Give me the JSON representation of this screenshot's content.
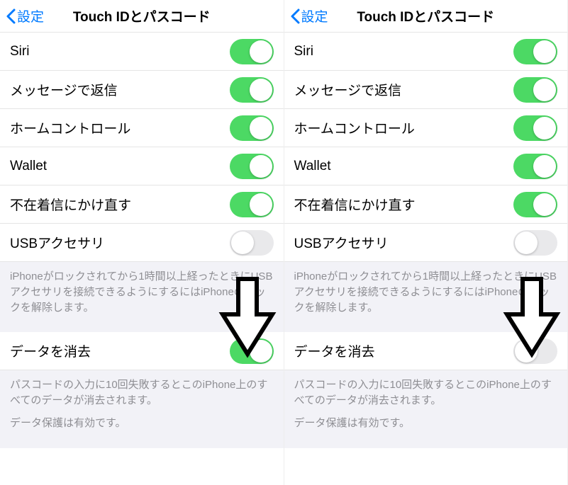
{
  "header": {
    "back_label": "設定",
    "title": "Touch IDとパスコード"
  },
  "rows": {
    "siri": {
      "label": "Siri",
      "on": true
    },
    "reply_message": {
      "label": "メッセージで返信",
      "on": true
    },
    "home_control": {
      "label": "ホームコントロール",
      "on": true
    },
    "wallet": {
      "label": "Wallet",
      "on": true
    },
    "return_missed": {
      "label": "不在着信にかけ直す",
      "on": true
    },
    "usb_accessory": {
      "label": "USBアクセサリ",
      "on": false
    },
    "erase_data": {
      "label": "データを消去"
    }
  },
  "notes": {
    "usb": "iPhoneがロックされてから1時間以上経ったときにUSBアクセサリを接続できるようにするにはiPhoneのロックを解除します。",
    "erase1": "パスコードの入力に10回失敗するとこのiPhone上のすべてのデータが消去されます。",
    "erase2": "データ保護は有効です。"
  },
  "panels": [
    {
      "erase_on": true
    },
    {
      "erase_on": false
    }
  ]
}
